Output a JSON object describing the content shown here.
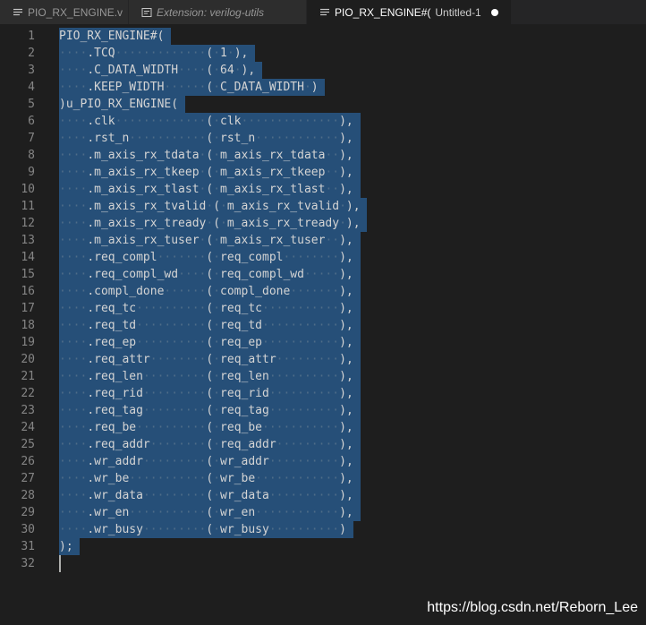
{
  "tabs": [
    {
      "label": "PIO_RX_ENGINE.v",
      "icon": "lines-icon",
      "active": false,
      "italic": false
    },
    {
      "label": "Extension: verilog-utils",
      "icon": "preview-icon",
      "active": false,
      "italic": true
    },
    {
      "label": "PIO_RX_ENGINE#(",
      "sub": "Untitled-1",
      "icon": "lines-icon",
      "active": true,
      "dirty": true
    }
  ],
  "lines": [
    {
      "n": "1",
      "text": "PIO_RX_ENGINE#("
    },
    {
      "n": "2",
      "text": "····.TCQ·············(·1·),"
    },
    {
      "n": "3",
      "text": "····.C_DATA_WIDTH····(·64·),"
    },
    {
      "n": "4",
      "text": "····.KEEP_WIDTH······(·C_DATA_WIDTH·)"
    },
    {
      "n": "5",
      "text": ")u_PIO_RX_ENGINE("
    },
    {
      "n": "6",
      "text": "····.clk·············(·clk··············),"
    },
    {
      "n": "7",
      "text": "····.rst_n···········(·rst_n············),"
    },
    {
      "n": "8",
      "text": "····.m_axis_rx_tdata·(·m_axis_rx_tdata··),"
    },
    {
      "n": "9",
      "text": "····.m_axis_rx_tkeep·(·m_axis_rx_tkeep··),"
    },
    {
      "n": "10",
      "text": "····.m_axis_rx_tlast·(·m_axis_rx_tlast··),"
    },
    {
      "n": "11",
      "text": "····.m_axis_rx_tvalid·(·m_axis_rx_tvalid·),"
    },
    {
      "n": "12",
      "text": "····.m_axis_rx_tready·(·m_axis_rx_tready·),"
    },
    {
      "n": "13",
      "text": "····.m_axis_rx_tuser·(·m_axis_rx_tuser··),"
    },
    {
      "n": "14",
      "text": "····.req_compl·······(·req_compl········),"
    },
    {
      "n": "15",
      "text": "····.req_compl_wd····(·req_compl_wd·····),"
    },
    {
      "n": "16",
      "text": "····.compl_done······(·compl_done·······),"
    },
    {
      "n": "17",
      "text": "····.req_tc··········(·req_tc···········),"
    },
    {
      "n": "18",
      "text": "····.req_td··········(·req_td···········),"
    },
    {
      "n": "19",
      "text": "····.req_ep··········(·req_ep···········),"
    },
    {
      "n": "20",
      "text": "····.req_attr········(·req_attr·········),"
    },
    {
      "n": "21",
      "text": "····.req_len·········(·req_len··········),"
    },
    {
      "n": "22",
      "text": "····.req_rid·········(·req_rid··········),"
    },
    {
      "n": "23",
      "text": "····.req_tag·········(·req_tag··········),"
    },
    {
      "n": "24",
      "text": "····.req_be··········(·req_be···········),"
    },
    {
      "n": "25",
      "text": "····.req_addr········(·req_addr·········),"
    },
    {
      "n": "26",
      "text": "····.wr_addr·········(·wr_addr··········),"
    },
    {
      "n": "27",
      "text": "····.wr_be···········(·wr_be············),"
    },
    {
      "n": "28",
      "text": "····.wr_data·········(·wr_data··········),"
    },
    {
      "n": "29",
      "text": "····.wr_en···········(·wr_en············),"
    },
    {
      "n": "30",
      "text": "····.wr_busy·········(·wr_busy··········)"
    },
    {
      "n": "31",
      "text": ");"
    },
    {
      "n": "32",
      "text": ""
    }
  ],
  "watermark": "https://blog.csdn.net/Reborn_Lee",
  "colors": {
    "background": "#1e1e1e",
    "selection": "#264f78",
    "number": "#b5cea8",
    "text": "#d4d4d4",
    "line_number": "#858585"
  }
}
